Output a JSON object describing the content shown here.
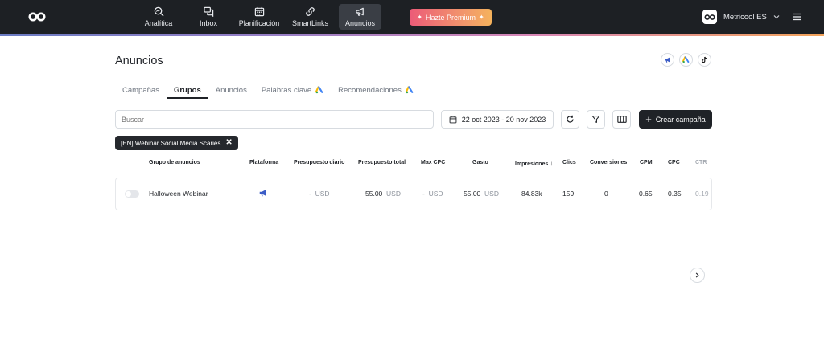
{
  "nav": {
    "items": [
      {
        "label": "Analítica",
        "icon": "analytics-icon"
      },
      {
        "label": "Inbox",
        "icon": "inbox-icon"
      },
      {
        "label": "Planificación",
        "icon": "calendar-icon"
      },
      {
        "label": "SmartLinks",
        "icon": "link-icon"
      },
      {
        "label": "Anuncios",
        "icon": "megaphone-icon",
        "active": true
      }
    ],
    "premium_label": "Hazte Premium",
    "account_name": "Metricool ES"
  },
  "page": {
    "title": "Anuncios"
  },
  "tabs": [
    {
      "label": "Campañas"
    },
    {
      "label": "Grupos",
      "active": true
    },
    {
      "label": "Anuncios"
    },
    {
      "label": "Palabras clave",
      "icon": "google-ads-icon"
    },
    {
      "label": "Recomendaciones",
      "icon": "google-ads-icon"
    }
  ],
  "toolbar": {
    "search_placeholder": "Buscar",
    "date_range": "22 oct 2023 - 20 nov 2023",
    "create_label": "Crear campaña"
  },
  "filter_chip": {
    "label": "[EN] Webinar Social Media Scaries"
  },
  "table": {
    "headers": [
      "Grupo de anuncios",
      "Plataforma",
      "Presupuesto diario",
      "Presupuesto total",
      "Max CPC",
      "Gasto",
      "Impresiones",
      "Clics",
      "Conversiones",
      "CPM",
      "CPC",
      "CTR"
    ],
    "row": {
      "name": "Halloween Webinar",
      "daily_budget": "-",
      "daily_budget_unit": "USD",
      "total_budget": "55.00",
      "total_budget_unit": "USD",
      "max_cpc": "-",
      "max_cpc_unit": "USD",
      "spend": "55.00",
      "spend_unit": "USD",
      "impressions": "84.83k",
      "clicks": "159",
      "conversions": "0",
      "cpm": "0.65",
      "cpc": "0.35",
      "ctr": "0.19"
    }
  },
  "colors": {
    "topbar": "#1d2024",
    "accent_dark": "#1f2227",
    "meta_blue": "#3b5cc6",
    "google_blue": "#4285f4",
    "google_yellow": "#fbbc04",
    "google_green": "#34a853"
  }
}
